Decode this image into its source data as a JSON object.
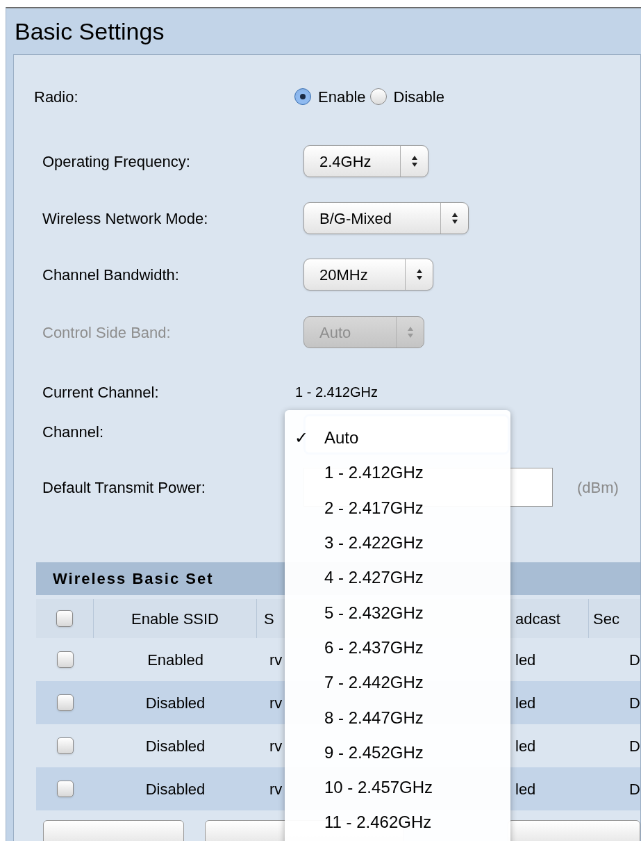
{
  "title": "Basic Settings",
  "radio": {
    "label": "Radio:",
    "options": [
      {
        "label": "Enable",
        "selected": true
      },
      {
        "label": "Disable",
        "selected": false
      }
    ]
  },
  "fields": [
    {
      "label": "Operating Frequency:",
      "value": "2.4GHz",
      "disabled": false
    },
    {
      "label": "Wireless Network Mode:",
      "value": "B/G-Mixed",
      "disabled": false
    },
    {
      "label": "Channel Bandwidth:",
      "value": "20MHz",
      "disabled": false
    },
    {
      "label": "Control Side Band:",
      "value": "Auto",
      "disabled": true
    }
  ],
  "current_channel": {
    "label": "Current Channel:",
    "value": "1 - 2.412GHz"
  },
  "channel": {
    "label": "Channel:"
  },
  "menu_check": "✓",
  "transmit_power": {
    "label": "Default Transmit Power:",
    "unit": "(dBm)"
  },
  "channel_menu": [
    {
      "label": "Auto",
      "selected": true
    },
    {
      "label": "1 - 2.412GHz",
      "selected": false
    },
    {
      "label": "2 - 2.417GHz",
      "selected": false
    },
    {
      "label": "3 - 2.422GHz",
      "selected": false
    },
    {
      "label": "4 - 2.427GHz",
      "selected": false
    },
    {
      "label": "5 - 2.432GHz",
      "selected": false
    },
    {
      "label": "6 - 2.437GHz",
      "selected": false
    },
    {
      "label": "7 - 2.442GHz",
      "selected": false
    },
    {
      "label": "8 - 2.447GHz",
      "selected": false
    },
    {
      "label": "9 - 2.452GHz",
      "selected": false
    },
    {
      "label": "10 - 2.457GHz",
      "selected": false
    },
    {
      "label": "11 - 2.462GHz",
      "selected": false
    }
  ],
  "table": {
    "title": "Wireless Basic Set",
    "header_checked": false,
    "columns": [
      "Enable SSID",
      "S",
      "adcast",
      "Sec"
    ],
    "rows": [
      {
        "checked": false,
        "cells": [
          "Enabled",
          "rv",
          "led",
          "D"
        ]
      },
      {
        "checked": false,
        "cells": [
          "Disabled",
          "rv",
          "led",
          "D"
        ]
      },
      {
        "checked": false,
        "cells": [
          "Disabled",
          "rv",
          "led",
          "D"
        ]
      },
      {
        "checked": false,
        "cells": [
          "Disabled",
          "rv",
          "led",
          "D"
        ]
      }
    ]
  }
}
